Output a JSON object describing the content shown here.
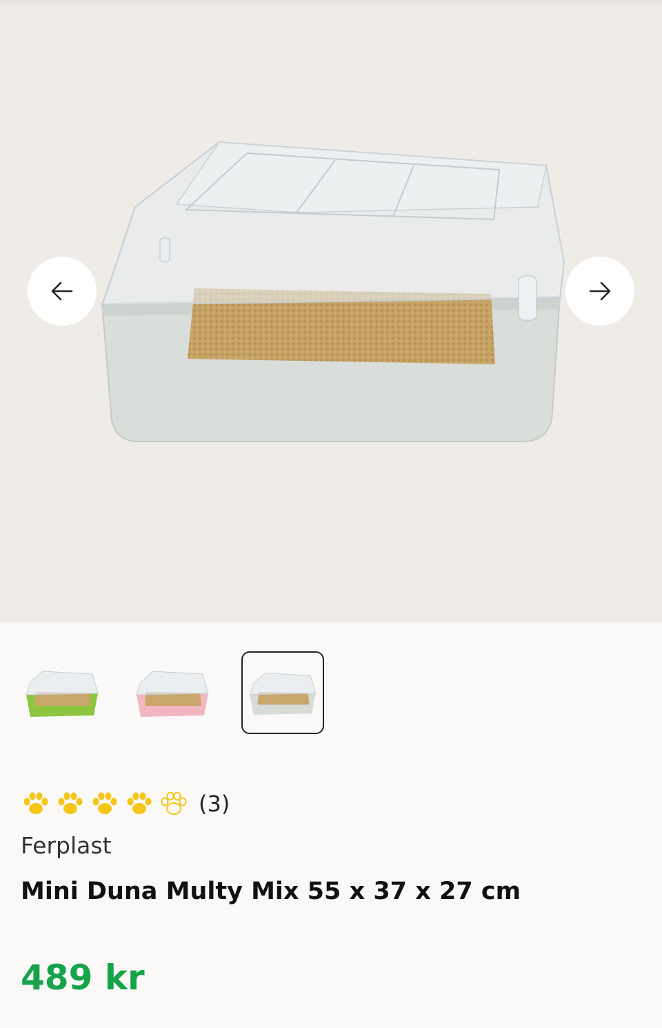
{
  "product": {
    "brand": "Ferplast",
    "name": "Mini Duna Multy Mix 55 x 37 x 27 cm",
    "price": "489 kr",
    "rating": {
      "filled": 4,
      "total": 5,
      "review_count": "(3)"
    }
  },
  "gallery": {
    "prev_icon": "arrow-left-icon",
    "next_icon": "arrow-right-icon",
    "thumbnails": [
      {
        "color": "green",
        "base_hex": "#8cc63f"
      },
      {
        "color": "pink",
        "base_hex": "#f2b6c0"
      },
      {
        "color": "grey",
        "base_hex": "#d6dcd8",
        "selected": true
      }
    ]
  },
  "colors": {
    "price": "#16a34a",
    "paw": "#f5c518",
    "hero_bg": "#efece7"
  }
}
